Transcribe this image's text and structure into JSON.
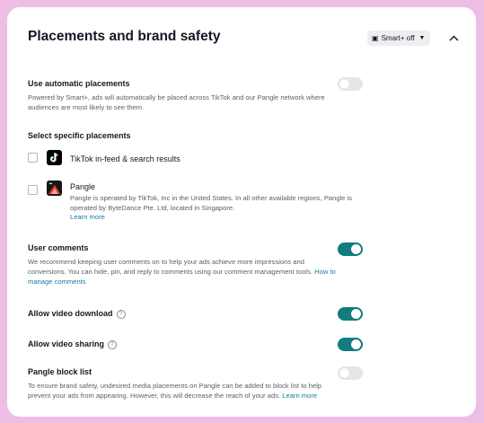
{
  "card": {
    "title": "Placements and brand safety",
    "smart_badge": {
      "icon": "smart-plus-icon",
      "label": "Smart+ off"
    }
  },
  "automatic": {
    "label": "Use automatic placements",
    "description": "Powered by Smart+, ads will automatically be placed across TikTok and our Pangle network where audiences are most likely to see them.",
    "enabled": false
  },
  "specific": {
    "label": "Select specific placements",
    "options": [
      {
        "name": "TikTok in-feed & search results",
        "icon": "tiktok-icon",
        "checked": false
      },
      {
        "name": "Pangle",
        "icon": "pangle-icon",
        "checked": false,
        "description": "Pangle is operated by TikTok, Inc in the United States. In all other available regions, Pangle is operated by ByteDance Pte. Ltd, located in Singapore.",
        "link": "Learn more"
      }
    ]
  },
  "comments": {
    "label": "User comments",
    "description": "We recommend keeping user comments on to help your ads achieve more impressions and conversions. You can hide, pin, and reply to comments using our comment management tools.",
    "link": "How to manage comments",
    "enabled": true
  },
  "download": {
    "label": "Allow video download",
    "enabled": true
  },
  "sharing": {
    "label": "Allow video sharing",
    "enabled": true
  },
  "blocklist": {
    "label": "Pangle block list",
    "description": "To ensure brand safety, undesired media placements on Pangle can be added to block list to help prevent your ads from appearing. However, this will decrease the reach of your ads.",
    "link": "Learn more",
    "enabled": false
  },
  "colors": {
    "accent": "#127c7e",
    "link": "#127da3",
    "background": "#eebde6"
  }
}
